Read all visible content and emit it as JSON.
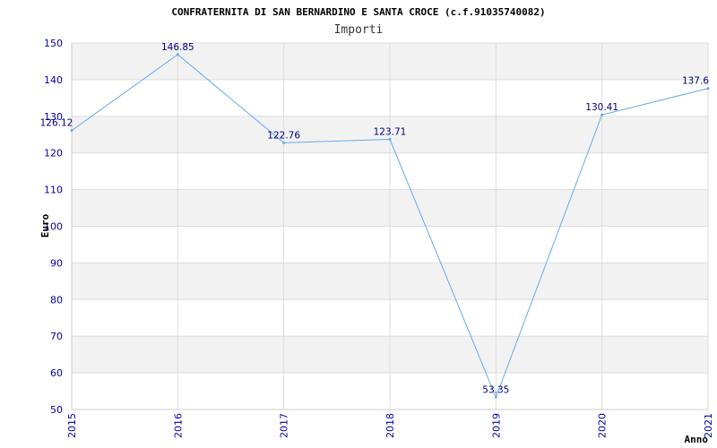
{
  "chart_data": {
    "type": "line",
    "title": "CONFRATERNITA DI SAN BERNARDINO E SANTA CROCE (c.f.91035740082)",
    "subtitle": "Importi",
    "xlabel": "Anno",
    "ylabel": "Euro",
    "categories": [
      "2015",
      "2016",
      "2017",
      "2018",
      "2019",
      "2020",
      "2021"
    ],
    "values": [
      126.12,
      146.85,
      122.76,
      123.71,
      53.35,
      130.41,
      137.6
    ],
    "data_labels": [
      "126.12",
      "146.85",
      "122.76",
      "123.71",
      "53.35",
      "130.41",
      "137.6"
    ],
    "ylim": [
      50,
      150
    ],
    "yticks": [
      50,
      60,
      70,
      80,
      90,
      100,
      110,
      120,
      130,
      140,
      150
    ],
    "grid": true,
    "colors": {
      "line": "#66aaee",
      "band": "#f2f2f2",
      "gridline": "#dddddd",
      "tick_text": "#0000aa",
      "label_text": "#000080"
    }
  }
}
